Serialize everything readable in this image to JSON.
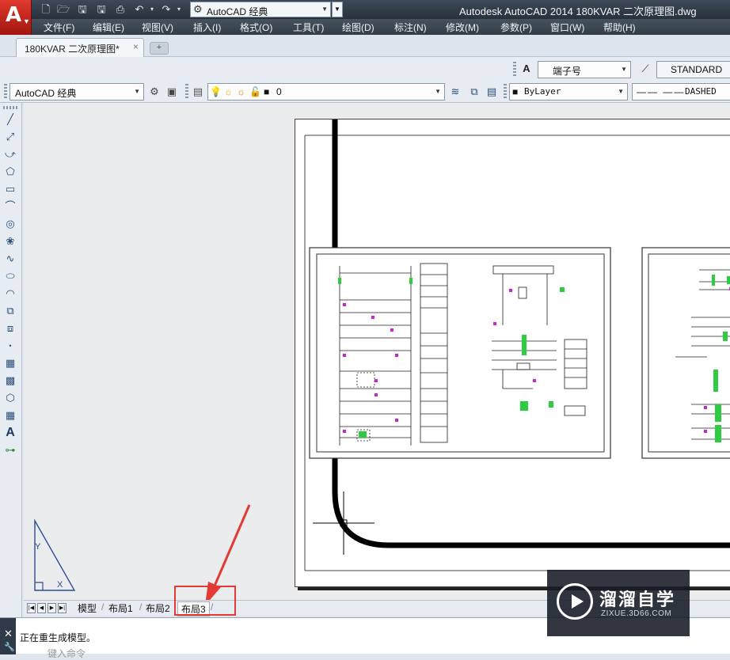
{
  "window_title": "Autodesk AutoCAD 2014    180KVAR 二次原理图.dwg",
  "workspace": "AutoCAD 经典",
  "quick_access": [
    "new-file-icon",
    "open-file-icon",
    "save-icon",
    "save-as-icon",
    "plot-icon",
    "undo-icon",
    "redo-icon"
  ],
  "menu": [
    "文件(F)",
    "编辑(E)",
    "视图(V)",
    "插入(I)",
    "格式(O)",
    "工具(T)",
    "绘图(D)",
    "标注(N)",
    "修改(M)",
    "参数(P)",
    "窗口(W)",
    "帮助(H)"
  ],
  "file_tab": {
    "label": "180KVAR 二次原理图*",
    "close": "×",
    "new_tab": "+"
  },
  "style_toolbar": {
    "text_style": "端子号",
    "dim_style": "STANDARD"
  },
  "layer_toolbar": {
    "workspace": "AutoCAD 经典",
    "layer": "0",
    "color": "ByLayer",
    "linetype": "DASHED"
  },
  "draw_tools": [
    "line-icon",
    "construction-line-icon",
    "polyline-icon",
    "polygon-icon",
    "rectangle-icon",
    "arc-icon",
    "circle-icon",
    "revision-cloud-icon",
    "spline-icon",
    "ellipse-icon",
    "ellipse-arc-icon",
    "insert-block-icon",
    "make-block-icon",
    "point-icon",
    "hatch-icon",
    "gradient-icon",
    "region-icon",
    "table-icon",
    "multiline-text-icon",
    "add-selected-icon"
  ],
  "layout_tabs": [
    "模型",
    "布局1",
    "布局2",
    "布局3"
  ],
  "command": {
    "history": "正在重生成模型。",
    "prompt": "键入命令"
  },
  "watermark": {
    "brand": "溜溜自学",
    "url": "ZIXUE.3D66.COM"
  },
  "colors": {
    "accent_red": "#e33a34",
    "title_bar": "#2e3845",
    "wire_green": "#2ecc40",
    "wire_magenta": "#d020d0"
  }
}
